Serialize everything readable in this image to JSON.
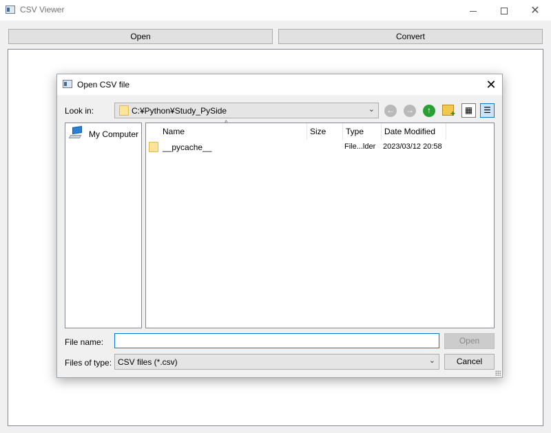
{
  "window": {
    "title": "CSV Viewer",
    "controls": {
      "minimize": "minimize",
      "maximize": "maximize",
      "close": "✕"
    }
  },
  "toolbar": {
    "open_label": "Open",
    "convert_label": "Convert"
  },
  "dialog": {
    "title": "Open CSV file",
    "look_in": {
      "label": "Look in:",
      "value": "C:¥Python¥Study_PySide"
    },
    "sidebar": {
      "items": [
        {
          "label": "My Computer",
          "icon": "computer-icon"
        }
      ]
    },
    "file_list": {
      "columns": [
        "Name",
        "Size",
        "Type",
        "Date Modified"
      ],
      "sort_indicator": "^",
      "rows": [
        {
          "name": "__pycache__",
          "size": "",
          "type": "File...lder",
          "date_modified": "2023/03/12 20:58"
        }
      ]
    },
    "file_name": {
      "label": "File name:",
      "value": "",
      "placeholder": ""
    },
    "file_type": {
      "label": "Files of type:",
      "value": "CSV files (*.csv)"
    },
    "buttons": {
      "open": "Open",
      "cancel": "Cancel"
    },
    "close_glyph": "✕"
  },
  "colors": {
    "accent": "#0078d7",
    "folder": "#fbe39a",
    "window_bg": "#f0f0f0"
  }
}
